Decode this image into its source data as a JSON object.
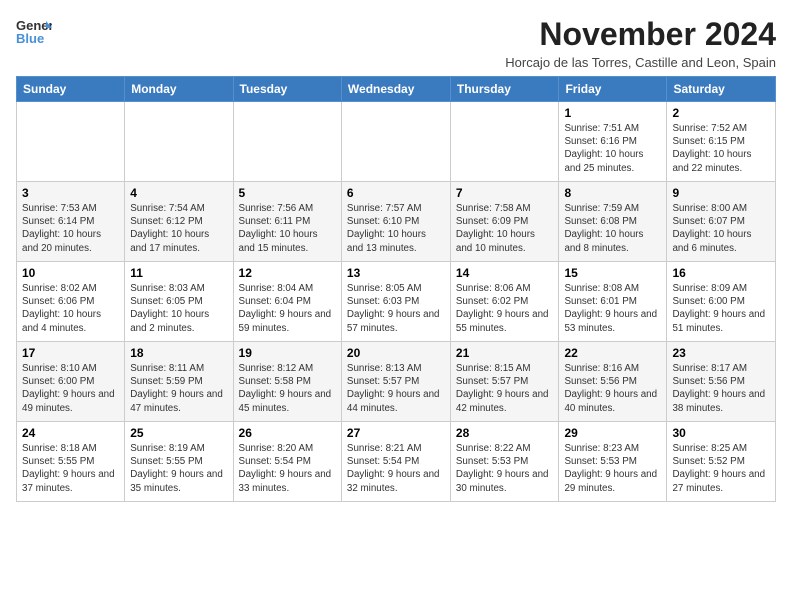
{
  "header": {
    "logo_line1": "General",
    "logo_line2": "Blue",
    "title": "November 2024",
    "subtitle": "Horcajo de las Torres, Castille and Leon, Spain"
  },
  "weekdays": [
    "Sunday",
    "Monday",
    "Tuesday",
    "Wednesday",
    "Thursday",
    "Friday",
    "Saturday"
  ],
  "weeks": [
    [
      {
        "day": "",
        "info": ""
      },
      {
        "day": "",
        "info": ""
      },
      {
        "day": "",
        "info": ""
      },
      {
        "day": "",
        "info": ""
      },
      {
        "day": "",
        "info": ""
      },
      {
        "day": "1",
        "info": "Sunrise: 7:51 AM\nSunset: 6:16 PM\nDaylight: 10 hours and 25 minutes."
      },
      {
        "day": "2",
        "info": "Sunrise: 7:52 AM\nSunset: 6:15 PM\nDaylight: 10 hours and 22 minutes."
      }
    ],
    [
      {
        "day": "3",
        "info": "Sunrise: 7:53 AM\nSunset: 6:14 PM\nDaylight: 10 hours and 20 minutes."
      },
      {
        "day": "4",
        "info": "Sunrise: 7:54 AM\nSunset: 6:12 PM\nDaylight: 10 hours and 17 minutes."
      },
      {
        "day": "5",
        "info": "Sunrise: 7:56 AM\nSunset: 6:11 PM\nDaylight: 10 hours and 15 minutes."
      },
      {
        "day": "6",
        "info": "Sunrise: 7:57 AM\nSunset: 6:10 PM\nDaylight: 10 hours and 13 minutes."
      },
      {
        "day": "7",
        "info": "Sunrise: 7:58 AM\nSunset: 6:09 PM\nDaylight: 10 hours and 10 minutes."
      },
      {
        "day": "8",
        "info": "Sunrise: 7:59 AM\nSunset: 6:08 PM\nDaylight: 10 hours and 8 minutes."
      },
      {
        "day": "9",
        "info": "Sunrise: 8:00 AM\nSunset: 6:07 PM\nDaylight: 10 hours and 6 minutes."
      }
    ],
    [
      {
        "day": "10",
        "info": "Sunrise: 8:02 AM\nSunset: 6:06 PM\nDaylight: 10 hours and 4 minutes."
      },
      {
        "day": "11",
        "info": "Sunrise: 8:03 AM\nSunset: 6:05 PM\nDaylight: 10 hours and 2 minutes."
      },
      {
        "day": "12",
        "info": "Sunrise: 8:04 AM\nSunset: 6:04 PM\nDaylight: 9 hours and 59 minutes."
      },
      {
        "day": "13",
        "info": "Sunrise: 8:05 AM\nSunset: 6:03 PM\nDaylight: 9 hours and 57 minutes."
      },
      {
        "day": "14",
        "info": "Sunrise: 8:06 AM\nSunset: 6:02 PM\nDaylight: 9 hours and 55 minutes."
      },
      {
        "day": "15",
        "info": "Sunrise: 8:08 AM\nSunset: 6:01 PM\nDaylight: 9 hours and 53 minutes."
      },
      {
        "day": "16",
        "info": "Sunrise: 8:09 AM\nSunset: 6:00 PM\nDaylight: 9 hours and 51 minutes."
      }
    ],
    [
      {
        "day": "17",
        "info": "Sunrise: 8:10 AM\nSunset: 6:00 PM\nDaylight: 9 hours and 49 minutes."
      },
      {
        "day": "18",
        "info": "Sunrise: 8:11 AM\nSunset: 5:59 PM\nDaylight: 9 hours and 47 minutes."
      },
      {
        "day": "19",
        "info": "Sunrise: 8:12 AM\nSunset: 5:58 PM\nDaylight: 9 hours and 45 minutes."
      },
      {
        "day": "20",
        "info": "Sunrise: 8:13 AM\nSunset: 5:57 PM\nDaylight: 9 hours and 44 minutes."
      },
      {
        "day": "21",
        "info": "Sunrise: 8:15 AM\nSunset: 5:57 PM\nDaylight: 9 hours and 42 minutes."
      },
      {
        "day": "22",
        "info": "Sunrise: 8:16 AM\nSunset: 5:56 PM\nDaylight: 9 hours and 40 minutes."
      },
      {
        "day": "23",
        "info": "Sunrise: 8:17 AM\nSunset: 5:56 PM\nDaylight: 9 hours and 38 minutes."
      }
    ],
    [
      {
        "day": "24",
        "info": "Sunrise: 8:18 AM\nSunset: 5:55 PM\nDaylight: 9 hours and 37 minutes."
      },
      {
        "day": "25",
        "info": "Sunrise: 8:19 AM\nSunset: 5:55 PM\nDaylight: 9 hours and 35 minutes."
      },
      {
        "day": "26",
        "info": "Sunrise: 8:20 AM\nSunset: 5:54 PM\nDaylight: 9 hours and 33 minutes."
      },
      {
        "day": "27",
        "info": "Sunrise: 8:21 AM\nSunset: 5:54 PM\nDaylight: 9 hours and 32 minutes."
      },
      {
        "day": "28",
        "info": "Sunrise: 8:22 AM\nSunset: 5:53 PM\nDaylight: 9 hours and 30 minutes."
      },
      {
        "day": "29",
        "info": "Sunrise: 8:23 AM\nSunset: 5:53 PM\nDaylight: 9 hours and 29 minutes."
      },
      {
        "day": "30",
        "info": "Sunrise: 8:25 AM\nSunset: 5:52 PM\nDaylight: 9 hours and 27 minutes."
      }
    ]
  ]
}
